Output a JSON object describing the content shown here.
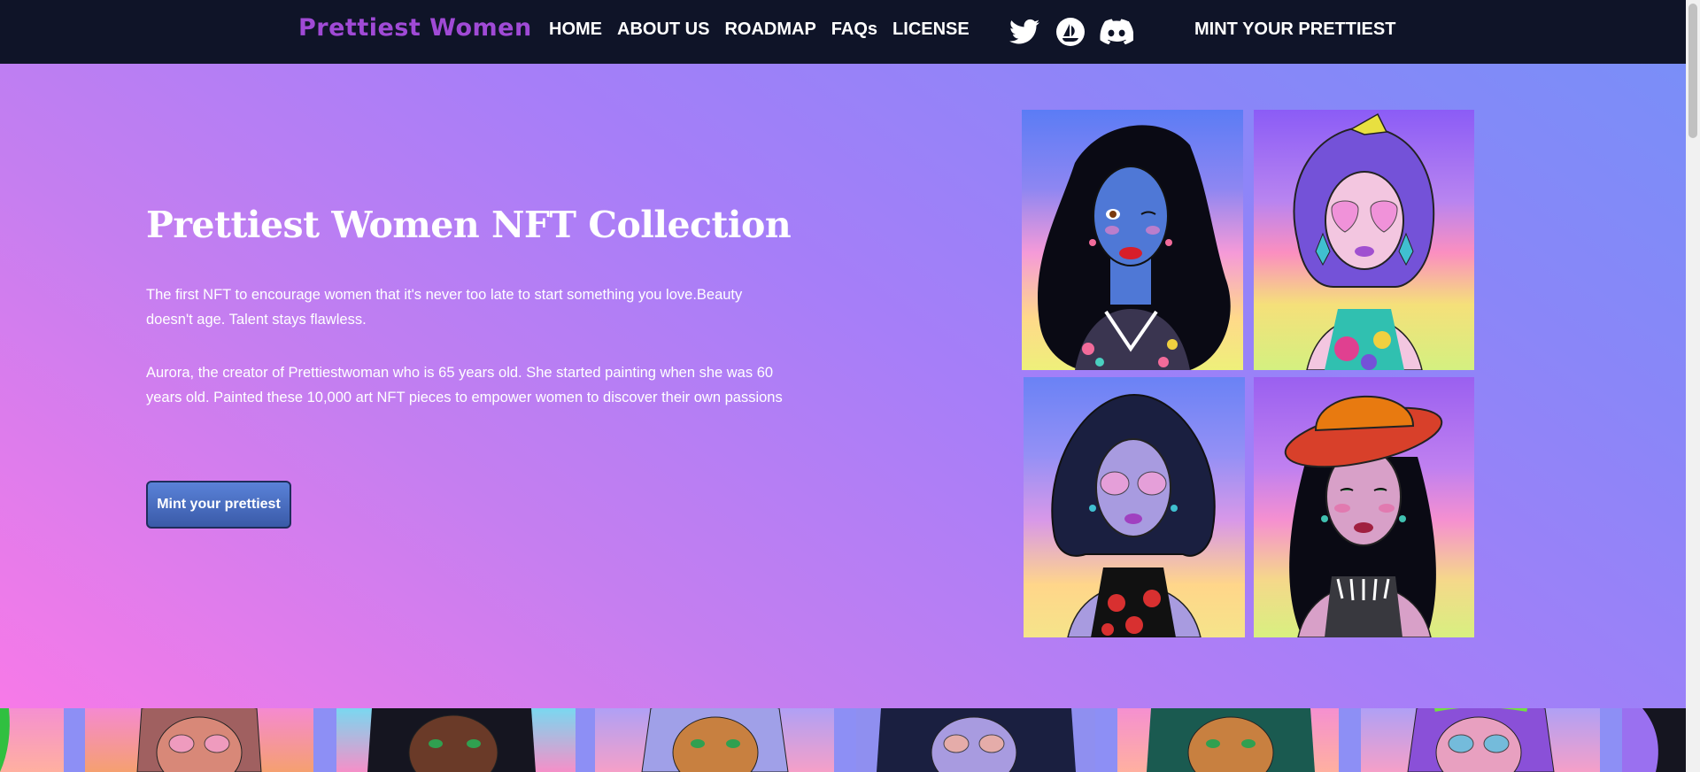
{
  "nav": {
    "logo": "Prettiest Women",
    "links": [
      "HOME",
      "ABOUT US",
      "ROADMAP",
      "FAQs",
      "LICENSE"
    ],
    "social": [
      "twitter-icon",
      "opensea-icon",
      "discord-icon"
    ],
    "mint": "MINT YOUR PRETTIEST"
  },
  "hero": {
    "title": "Prettiest Women NFT Collection",
    "p1": "The first NFT to encourage women that it's never too late to start something you love.Beauty doesn't age. Talent stays flawless.",
    "p2": "Aurora, the creator of Prettiestwoman who is 65 years old. She started painting when she was 60 years old. Painted these 10,000 art NFT pieces to empower women to discover their own passions",
    "cta": "Mint your prettiest"
  },
  "colors": {
    "nav_bg": "#0f1428",
    "logo": "#a04ad6",
    "hero_pink": "#f77ae8",
    "hero_blue": "#7a8ef8",
    "button": "#4a6cc0"
  }
}
